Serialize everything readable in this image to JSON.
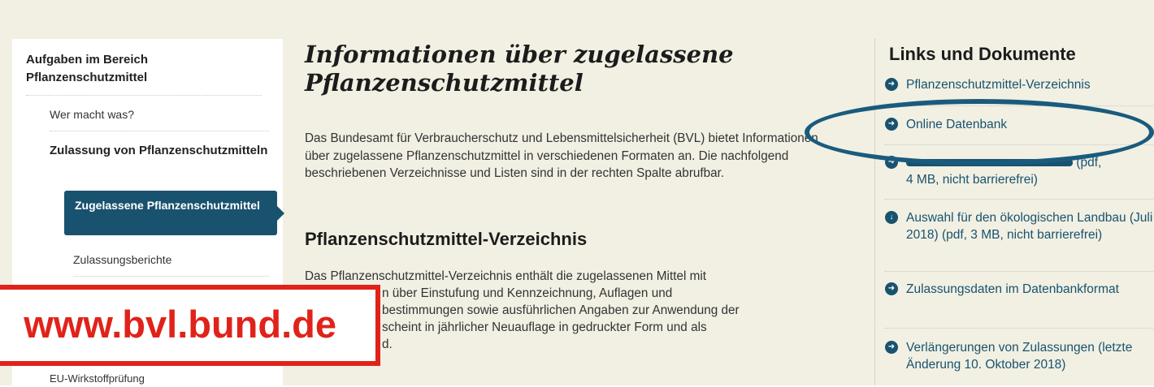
{
  "sidebar": {
    "heading": "Aufgaben im Bereich Pflanzenschutzmittel",
    "items": [
      {
        "label": "Wer macht was?"
      },
      {
        "label": "Zulassung von Pflanzenschutzmitteln"
      },
      {
        "label": "Zugelassene Pflanzenschutzmittel"
      },
      {
        "label": "Zulassungsberichte"
      },
      {
        "label": "EU-Wirkstoffprüfung"
      }
    ]
  },
  "main": {
    "title": "Informationen über zugelassene Pflanzenschutzmittel",
    "intro": "Das Bundesamt für Verbraucherschutz und Lebensmittelsicherheit (BVL) bietet Informationen über zugelassene Pflanzenschutzmittel in verschiedenen Formaten an. Die nachfolgend beschriebenen Verzeichnisse und Listen sind in der rechten Spalte abrufbar.",
    "section_title": "Pflanzenschutzmittel-Verzeichnis",
    "section_line1": "Das Pflanzenschutzmittel-Verzeichnis enthält die zugelassenen Mittel mit",
    "section_line2": "n über Einstufung und Kennzeichnung, Auflagen und",
    "section_line3": "bestimmungen sowie ausführlichen Angaben zur Anwendung der",
    "section_line4": "scheint in jährlicher Neuauflage in gedruckter Form und als",
    "section_line5": "d."
  },
  "right": {
    "title": "Links und Dokumente",
    "links": [
      {
        "label": "Pflanzenschutzmittel-Verzeichnis",
        "icon": "arrow-right-icon"
      },
      {
        "label": "Online Datenbank",
        "icon": "arrow-right-icon"
      },
      {
        "label_suffix": "(pdf,",
        "label_line2": "4 MB, nicht barrierefrei)",
        "icon": "arrow-right-icon"
      },
      {
        "label": "Auswahl für den ökologischen Landbau (Juli 2018) (pdf, 3 MB, nicht barrierefrei)",
        "icon": "download-icon"
      },
      {
        "label": "Zulassungsdaten im Datenbankformat",
        "icon": "arrow-right-icon"
      },
      {
        "label": "Verlängerungen von Zulassungen (letzte Änderung 10. Oktober 2018)",
        "icon": "arrow-right-icon"
      }
    ]
  },
  "overlay": {
    "url": "www.bvl.bund.de"
  },
  "colors": {
    "accent": "#19526f",
    "background": "#f1f0e3",
    "annotation_red": "#e0231a",
    "annotation_ellipse": "#1a5b7d"
  }
}
